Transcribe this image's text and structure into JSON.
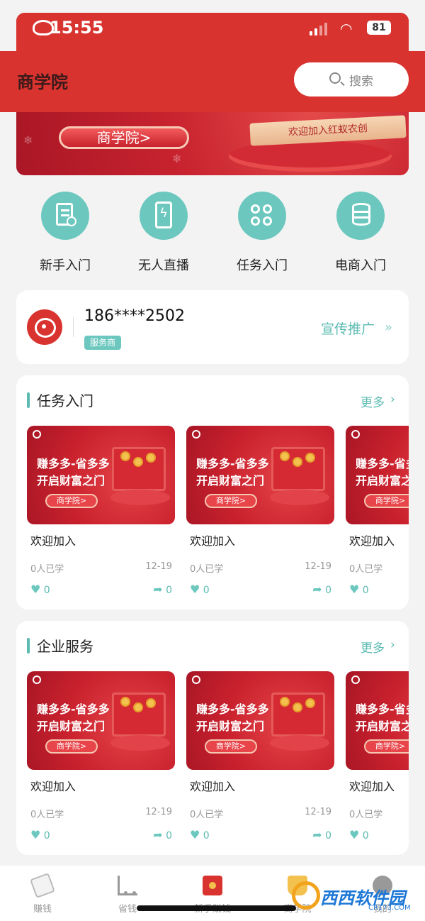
{
  "status_bar": {
    "time": "15:55",
    "battery": "81"
  },
  "header": {
    "title": "商学院",
    "search_placeholder": "搜索"
  },
  "banner": {
    "button_label": "商学院>",
    "ribbon_text": "欢迎加入红蚁农创"
  },
  "quick_entries": [
    {
      "label": "新手入门",
      "icon": "document-clock-icon"
    },
    {
      "label": "无人直播",
      "icon": "phone-lightning-icon"
    },
    {
      "label": "任务入门",
      "icon": "four-circles-icon"
    },
    {
      "label": "电商入门",
      "icon": "database-user-icon"
    }
  ],
  "provider": {
    "phone": "186****2502",
    "badge": "服务商",
    "promo_label": "宣传推广",
    "promo_arrow": "»"
  },
  "sections": [
    {
      "title": "任务入门",
      "more_label": "更多",
      "courses": [
        {
          "thumb_line1": "赚多多-省多多",
          "thumb_line2": "开启财富之门",
          "thumb_button": "商学院>",
          "name": "欢迎加入",
          "learners": "0人已学",
          "date": "12-19",
          "likes": "0",
          "shares": "0"
        },
        {
          "thumb_line1": "赚多多-省多多",
          "thumb_line2": "开启财富之门",
          "thumb_button": "商学院>",
          "name": "欢迎加入",
          "learners": "0人已学",
          "date": "12-19",
          "likes": "0",
          "shares": "0"
        },
        {
          "thumb_line1": "赚多多-省多多",
          "thumb_line2": "开启财富之门",
          "thumb_button": "商学院>",
          "name": "欢迎加入",
          "learners": "0人已学",
          "date": "",
          "likes": "0",
          "shares": ""
        }
      ]
    },
    {
      "title": "企业服务",
      "more_label": "更多",
      "courses": [
        {
          "thumb_line1": "赚多多-省多多",
          "thumb_line2": "开启财富之门",
          "thumb_button": "商学院>",
          "name": "欢迎加入",
          "learners": "0人已学",
          "date": "12-19",
          "likes": "0",
          "shares": "0"
        },
        {
          "thumb_line1": "赚多多-省多多",
          "thumb_line2": "开启财富之门",
          "thumb_button": "商学院>",
          "name": "欢迎加入",
          "learners": "0人已学",
          "date": "12-19",
          "likes": "0",
          "shares": "0"
        },
        {
          "thumb_line1": "赚多多-省多多",
          "thumb_line2": "开启财富之门",
          "thumb_button": "商学院>",
          "name": "欢迎加入",
          "learners": "0人已学",
          "date": "",
          "likes": "0",
          "shares": ""
        }
      ]
    }
  ],
  "tabbar": [
    {
      "label": "赚钱",
      "icon": "earn-icon"
    },
    {
      "label": "省钱",
      "icon": "cart-icon"
    },
    {
      "label": "新手赚钱",
      "icon": "red-packet-icon"
    },
    {
      "label": "商学院",
      "icon": "graduation-cap-icon"
    },
    {
      "label": "我的",
      "icon": "user-icon"
    }
  ],
  "watermark": {
    "text": "西西软件园",
    "domain": "CR173.COM"
  },
  "colors": {
    "brand_red": "#d9332f",
    "accent_teal": "#5bbbb2",
    "icon_teal": "#6cc8bf",
    "background": "#f3f3f3"
  }
}
